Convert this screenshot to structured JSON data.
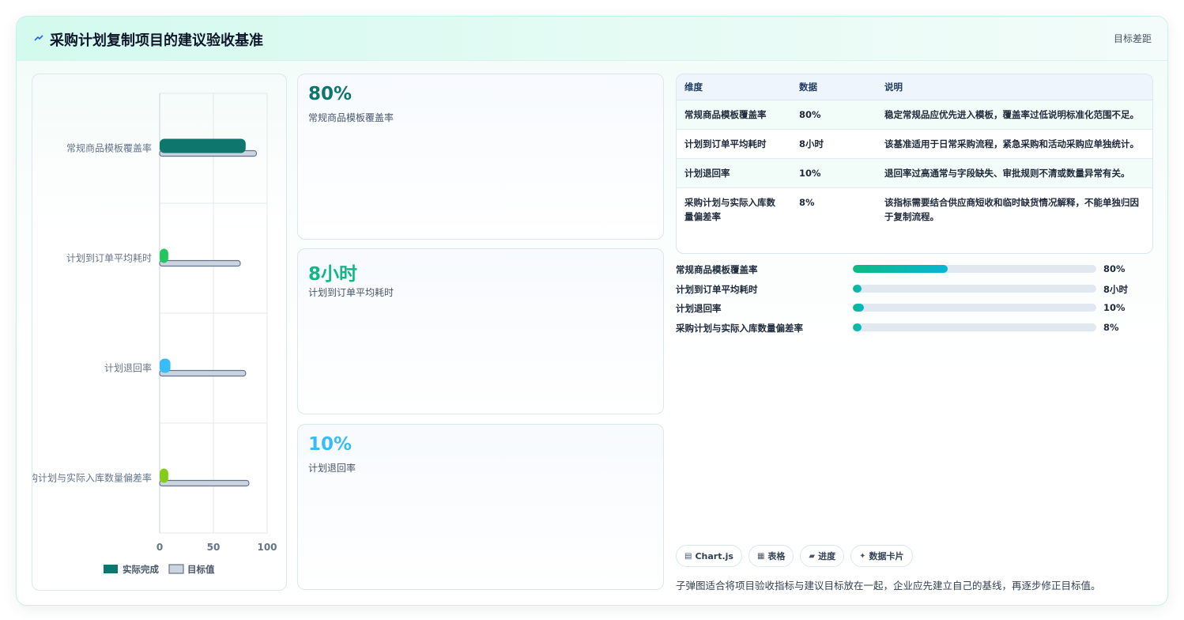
{
  "header": {
    "title": "采购计划复制项目的建议验收基准",
    "tag": "目标差距",
    "icon": "lightning-icon"
  },
  "chart_data": {
    "type": "bar",
    "orientation": "horizontal",
    "categories": [
      "常规商品模板覆盖率",
      "计划到订单平均耗时",
      "计划退回率",
      "采购计划与实际入库数量偏差率"
    ],
    "series": [
      {
        "name": "实际完成",
        "values": [
          80,
          8,
          10,
          8
        ],
        "colors": [
          "#0f766e",
          "#22c55e",
          "#38bdf8",
          "#84cc16"
        ]
      },
      {
        "name": "目标值",
        "values": [
          90,
          75,
          80,
          83
        ],
        "color": "#cbd5e1"
      }
    ],
    "xlim": [
      0,
      100
    ],
    "xticks": [
      0,
      50,
      100
    ],
    "grid": true,
    "legend_position": "bottom"
  },
  "kpis": [
    {
      "value": "80%",
      "label": "常规商品模板覆盖率",
      "color": "#0f766e"
    },
    {
      "value": "8小时",
      "label": "计划到订单平均耗时",
      "color": "#10b981"
    },
    {
      "value": "10%",
      "label": "计划退回率",
      "color": "#38bdf8"
    }
  ],
  "table": {
    "headers": [
      "维度",
      "数据",
      "说明"
    ],
    "rows": [
      [
        "常规商品模板覆盖率",
        "80%",
        "稳定常规品应优先进入模板，覆盖率过低说明标准化范围不足。"
      ],
      [
        "计划到订单平均耗时",
        "8小时",
        "该基准适用于日常采购流程，紧急采购和活动采购应单独统计。"
      ],
      [
        "计划退回率",
        "10%",
        "退回率过高通常与字段缺失、审批规则不清或数量异常有关。"
      ],
      [
        "采购计划与实际入库数量偏差率",
        "8%",
        "该指标需要结合供应商短收和临时缺货情况解释，不能单独归因于复制流程。"
      ]
    ]
  },
  "progress": [
    {
      "label": "常规商品模板覆盖率",
      "value_text": "80%",
      "fraction": 0.39
    },
    {
      "label": "计划到订单平均耗时",
      "value_text": "8小时",
      "fraction": 0.035
    },
    {
      "label": "计划退回率",
      "value_text": "10%",
      "fraction": 0.045
    },
    {
      "label": "采购计划与实际入库数量偏差率",
      "value_text": "8%",
      "fraction": 0.035
    }
  ],
  "chips": [
    {
      "icon": "chart-icon",
      "glyph": "▤",
      "label": "Chart.js"
    },
    {
      "icon": "table-icon",
      "glyph": "▦",
      "label": "表格"
    },
    {
      "icon": "progress-icon",
      "glyph": "▰",
      "label": "进度"
    },
    {
      "icon": "sparkle-icon",
      "glyph": "✦",
      "label": "数据卡片"
    }
  ],
  "note": "子弹图适合将项目验收指标与建议目标放在一起，企业应先建立自己的基线，再逐步修正目标值。"
}
